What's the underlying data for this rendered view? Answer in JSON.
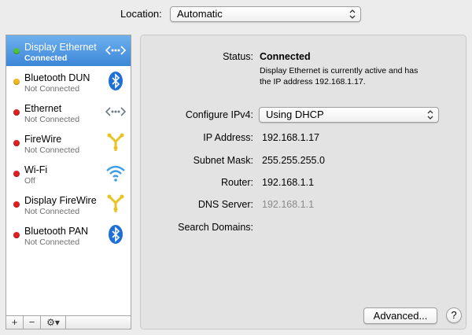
{
  "location": {
    "label": "Location:",
    "value": "Automatic"
  },
  "colors": {
    "green": "#4ec33d",
    "yellow": "#f2b820",
    "red": "#e02020",
    "bluetooth": "#1e6fd6",
    "firewire": "#e8c322",
    "wifi": "#3a9ee8"
  },
  "services": [
    {
      "name": "Display Ethernet",
      "status": "Connected",
      "dot": "green",
      "icon": "ethernet-icon"
    },
    {
      "name": "Bluetooth DUN",
      "status": "Not Connected",
      "dot": "yellow",
      "icon": "bluetooth-icon"
    },
    {
      "name": "Ethernet",
      "status": "Not Connected",
      "dot": "red",
      "icon": "ethernet-icon"
    },
    {
      "name": "FireWire",
      "status": "Not Connected",
      "dot": "red",
      "icon": "firewire-icon"
    },
    {
      "name": "Wi-Fi",
      "status": "Off",
      "dot": "red",
      "icon": "wifi-icon"
    },
    {
      "name": "Display FireWire",
      "status": "Not Connected",
      "dot": "red",
      "icon": "firewire-icon"
    },
    {
      "name": "Bluetooth PAN",
      "status": "Not Connected",
      "dot": "red",
      "icon": "bluetooth-icon"
    }
  ],
  "toolbar": {
    "add": "+",
    "remove": "−",
    "gear": "⚙▾"
  },
  "detail": {
    "status_label": "Status:",
    "status_value": "Connected",
    "status_desc_1": "Display Ethernet is currently active and has",
    "status_desc_2": "the IP address 192.168.1.17.",
    "configure_label": "Configure IPv4:",
    "configure_value": "Using DHCP",
    "ip_label": "IP Address:",
    "ip_value": "192.168.1.17",
    "subnet_label": "Subnet Mask:",
    "subnet_value": "255.255.255.0",
    "router_label": "Router:",
    "router_value": "192.168.1.1",
    "dns_label": "DNS Server:",
    "dns_value": "192.168.1.1",
    "search_label": "Search Domains:",
    "advanced_label": "Advanced...",
    "help_label": "?"
  }
}
